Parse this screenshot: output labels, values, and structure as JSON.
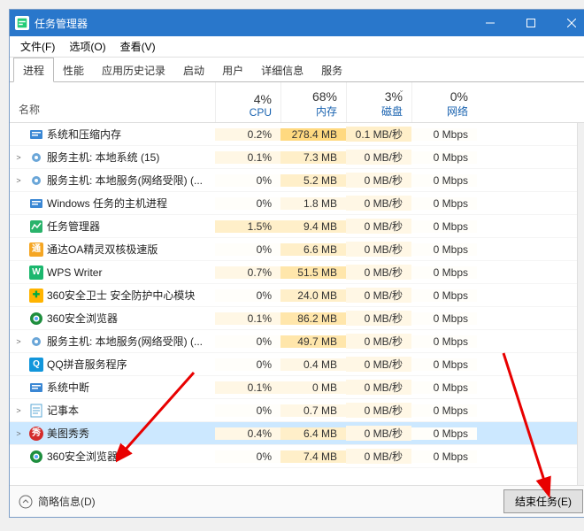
{
  "titlebar": {
    "title": "任务管理器"
  },
  "menubar": {
    "file": "文件(F)",
    "options": "选项(O)",
    "view": "查看(V)"
  },
  "tabs": [
    "进程",
    "性能",
    "应用历史记录",
    "启动",
    "用户",
    "详细信息",
    "服务"
  ],
  "columns": {
    "name": "名称",
    "cpu": {
      "pct": "4%",
      "label": "CPU"
    },
    "mem": {
      "pct": "68%",
      "label": "内存"
    },
    "disk": {
      "pct": "3%",
      "label": "磁盘"
    },
    "net": {
      "pct": "0%",
      "label": "网络"
    }
  },
  "rows": [
    {
      "exp": "",
      "icon": "sys",
      "name": "系统和压缩内存",
      "cpu": "0.2%",
      "ch": 1,
      "mem": "278.4 MB",
      "mh": 4,
      "disk": "0.1 MB/秒",
      "dh": 2,
      "net": "0 Mbps",
      "nh": 0
    },
    {
      "exp": ">",
      "icon": "gear",
      "name": "服务主机: 本地系统 (15)",
      "cpu": "0.1%",
      "ch": 1,
      "mem": "7.3 MB",
      "mh": 2,
      "disk": "0 MB/秒",
      "dh": 1,
      "net": "0 Mbps",
      "nh": 0
    },
    {
      "exp": ">",
      "icon": "gear",
      "name": "服务主机: 本地服务(网络受限) (...",
      "cpu": "0%",
      "ch": 0,
      "mem": "5.2 MB",
      "mh": 2,
      "disk": "0 MB/秒",
      "dh": 1,
      "net": "0 Mbps",
      "nh": 0
    },
    {
      "exp": "",
      "icon": "sys",
      "name": "Windows 任务的主机进程",
      "cpu": "0%",
      "ch": 0,
      "mem": "1.8 MB",
      "mh": 1,
      "disk": "0 MB/秒",
      "dh": 1,
      "net": "0 Mbps",
      "nh": 0
    },
    {
      "exp": "",
      "icon": "tm",
      "name": "任务管理器",
      "cpu": "1.5%",
      "ch": 2,
      "mem": "9.4 MB",
      "mh": 2,
      "disk": "0 MB/秒",
      "dh": 1,
      "net": "0 Mbps",
      "nh": 0
    },
    {
      "exp": "",
      "icon": "tongda",
      "name": "通达OA精灵双核极速版",
      "cpu": "0%",
      "ch": 0,
      "mem": "6.6 MB",
      "mh": 2,
      "disk": "0 MB/秒",
      "dh": 1,
      "net": "0 Mbps",
      "nh": 0
    },
    {
      "exp": "",
      "icon": "wps",
      "name": "WPS Writer",
      "cpu": "0.7%",
      "ch": 1,
      "mem": "51.5 MB",
      "mh": 3,
      "disk": "0 MB/秒",
      "dh": 1,
      "net": "0 Mbps",
      "nh": 0
    },
    {
      "exp": "",
      "icon": "360s",
      "name": "360安全卫士 安全防护中心模块",
      "cpu": "0%",
      "ch": 0,
      "mem": "24.0 MB",
      "mh": 2,
      "disk": "0 MB/秒",
      "dh": 1,
      "net": "0 Mbps",
      "nh": 0
    },
    {
      "exp": "",
      "icon": "360b",
      "name": "360安全浏览器",
      "cpu": "0.1%",
      "ch": 1,
      "mem": "86.2 MB",
      "mh": 3,
      "disk": "0 MB/秒",
      "dh": 1,
      "net": "0 Mbps",
      "nh": 0
    },
    {
      "exp": ">",
      "icon": "gear",
      "name": "服务主机: 本地服务(网络受限) (...",
      "cpu": "0%",
      "ch": 0,
      "mem": "49.7 MB",
      "mh": 3,
      "disk": "0 MB/秒",
      "dh": 1,
      "net": "0 Mbps",
      "nh": 0
    },
    {
      "exp": "",
      "icon": "qq",
      "name": "QQ拼音服务程序",
      "cpu": "0%",
      "ch": 0,
      "mem": "0.4 MB",
      "mh": 1,
      "disk": "0 MB/秒",
      "dh": 1,
      "net": "0 Mbps",
      "nh": 0
    },
    {
      "exp": "",
      "icon": "sys",
      "name": "系统中断",
      "cpu": "0.1%",
      "ch": 1,
      "mem": "0 MB",
      "mh": 1,
      "disk": "0 MB/秒",
      "dh": 1,
      "net": "0 Mbps",
      "nh": 0
    },
    {
      "exp": ">",
      "icon": "note",
      "name": "记事本",
      "cpu": "0%",
      "ch": 0,
      "mem": "0.7 MB",
      "mh": 1,
      "disk": "0 MB/秒",
      "dh": 1,
      "net": "0 Mbps",
      "nh": 0
    },
    {
      "exp": ">",
      "icon": "meitu",
      "name": "美图秀秀",
      "cpu": "0.4%",
      "ch": 1,
      "mem": "6.4 MB",
      "mh": 2,
      "disk": "0 MB/秒",
      "dh": 1,
      "net": "0 Mbps",
      "nh": 0,
      "selected": true
    },
    {
      "exp": "",
      "icon": "360b",
      "name": "360安全浏览器",
      "cpu": "0%",
      "ch": 0,
      "mem": "7.4 MB",
      "mh": 2,
      "disk": "0 MB/秒",
      "dh": 1,
      "net": "0 Mbps",
      "nh": 0
    }
  ],
  "footer": {
    "fewer": "简略信息(D)",
    "endtask": "结束任务(E)"
  }
}
